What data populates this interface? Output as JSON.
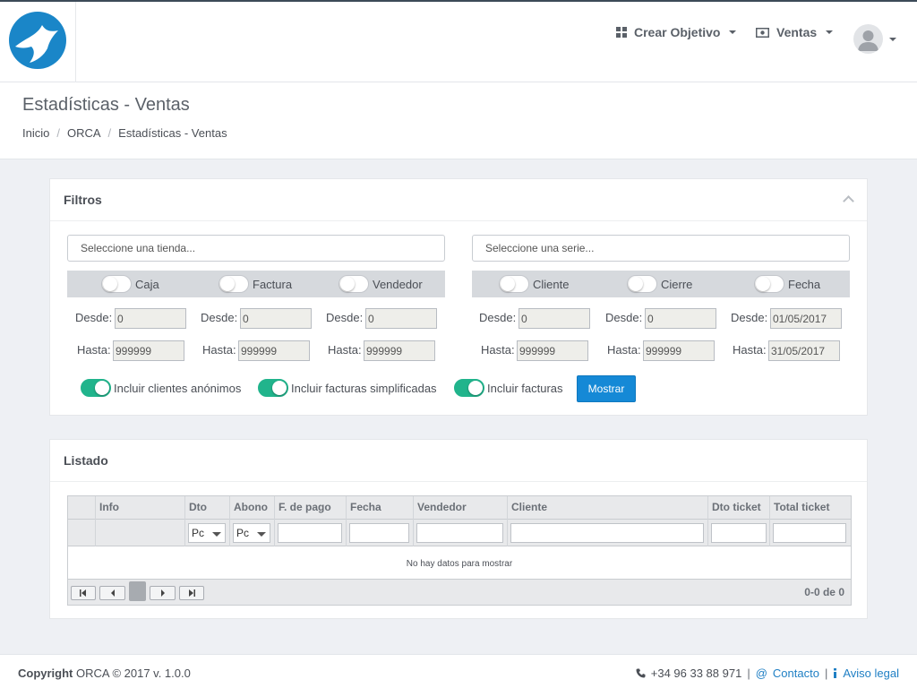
{
  "header": {
    "crear_objetivo_label": "Crear Objetivo",
    "ventas_label": "Ventas"
  },
  "page": {
    "title": "Estadísticas - Ventas",
    "breadcrumb": [
      "Inicio",
      "ORCA",
      "Estadísticas - Ventas"
    ]
  },
  "filtros": {
    "title": "Filtros",
    "tienda_placeholder": "Seleccione una tienda...",
    "serie_placeholder": "Seleccione una serie...",
    "toggles_left": [
      "Caja",
      "Factura",
      "Vendedor"
    ],
    "toggles_right": [
      "Cliente",
      "Cierre",
      "Fecha"
    ],
    "desde_label": "Desde:",
    "hasta_label": "Hasta:",
    "ranges": [
      {
        "desde": "0",
        "hasta": "999999"
      },
      {
        "desde": "0",
        "hasta": "999999"
      },
      {
        "desde": "0",
        "hasta": "999999"
      },
      {
        "desde": "0",
        "hasta": "999999"
      },
      {
        "desde": "0",
        "hasta": "999999"
      },
      {
        "desde": "01/05/2017",
        "hasta": "31/05/2017"
      }
    ],
    "options": [
      "Incluir clientes anónimos",
      "Incluir facturas simplificadas",
      "Incluir facturas"
    ],
    "mostrar_label": "Mostrar"
  },
  "listado": {
    "title": "Listado",
    "columns": [
      "",
      "Info",
      "Dto",
      "Abono",
      "F. de pago",
      "Fecha",
      "Vendedor",
      "Cliente",
      "Dto ticket",
      "Total ticket"
    ],
    "dto_filter": "Pc",
    "abono_filter": "Pc",
    "empty_text": "No hay datos para mostrar",
    "current_page": "1",
    "page_info": "0-0 de 0"
  },
  "footer": {
    "copyright_bold": "Copyright",
    "copyright_rest": " ORCA © 2017 v. 1.0.0",
    "phone": "+34 96 33 88 971",
    "contacto": "Contacto",
    "aviso": "Aviso legal"
  },
  "colors": {
    "primary": "#1589d6",
    "toggle_on": "#21b48c",
    "logo": "#1a86c8"
  }
}
